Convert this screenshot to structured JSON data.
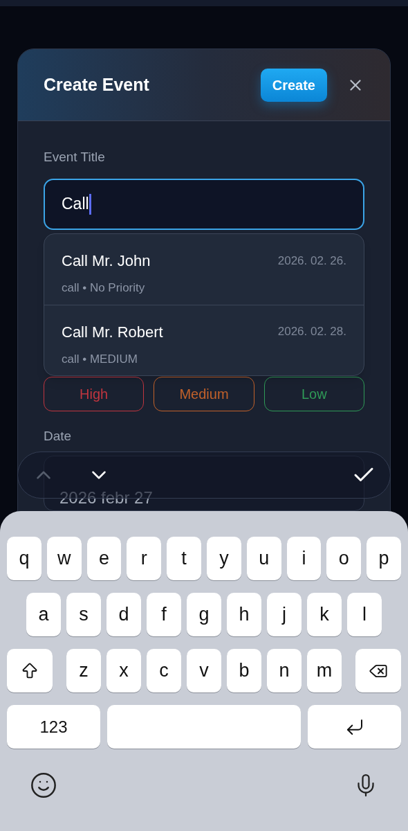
{
  "header": {
    "title": "Create Event",
    "create_button": "Create"
  },
  "title_field": {
    "label": "Event Title",
    "value": "Call"
  },
  "suggestions": [
    {
      "title": "Call Mr. John",
      "date": "2026. 02. 26.",
      "meta": "call • No Priority"
    },
    {
      "title": "Call Mr. Robert",
      "date": "2026. 02. 28.",
      "meta": "call • MEDIUM"
    }
  ],
  "priority": {
    "options": [
      {
        "label": "High",
        "color": "#c0353f",
        "selected": false
      },
      {
        "label": "Medium",
        "color": "#c2612a",
        "selected": false
      },
      {
        "label": "Low",
        "color": "#2f9a57",
        "selected": false
      }
    ]
  },
  "date_field": {
    "label": "Date",
    "value": "2026 febr 27"
  },
  "input_toolbar": {
    "previous": {
      "disabled": true
    },
    "next": {
      "disabled": false
    }
  },
  "keyboard": {
    "rows": [
      [
        "q",
        "w",
        "e",
        "r",
        "t",
        "y",
        "u",
        "i",
        "o",
        "p"
      ],
      [
        "a",
        "s",
        "d",
        "f",
        "g",
        "h",
        "j",
        "k",
        "l"
      ],
      [
        "z",
        "x",
        "c",
        "v",
        "b",
        "n",
        "m"
      ]
    ],
    "numbers_key": "123"
  }
}
